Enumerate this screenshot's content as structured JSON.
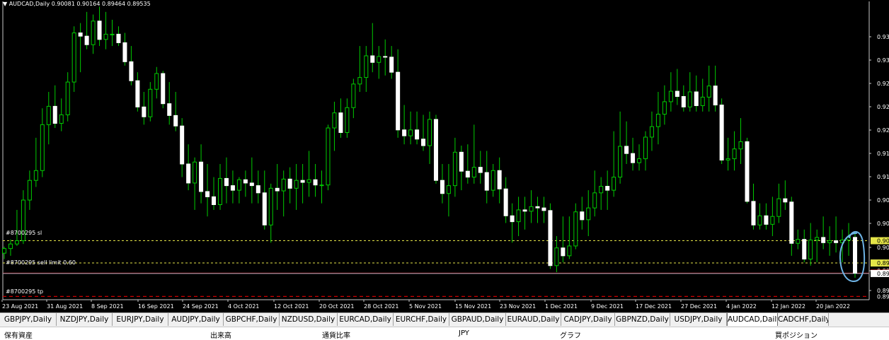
{
  "symbol_header": "AUDCAD,Daily  0.90081 0.90164 0.89464 0.89535",
  "orders": {
    "sl": "#8700295 sl",
    "sell_limit": "#8700295 sell limit 0.60",
    "tp": "#8700295 tp"
  },
  "chart_data": {
    "type": "candlestick",
    "symbol": "AUDCAD",
    "timeframe": "Daily",
    "last_ohlc": {
      "open": 0.90081,
      "high": 0.90164,
      "low": 0.89464,
      "close": 0.89535
    },
    "ylim": [
      0.8913,
      0.9368
    ],
    "y_ticks": [
      "0.93",
      "0.93",
      "0.92",
      "0.92",
      "0.92",
      "0.91",
      "0.91",
      "0.90",
      "0.90",
      "0.90",
      "0.89",
      "0.89"
    ],
    "x_labels": [
      "23 Aug 2021",
      "31 Aug 2021",
      "8 Sep 2021",
      "16 Sep 2021",
      "24 Sep 2021",
      "4 Oct 2021",
      "12 Oct 2021",
      "20 Oct 2021",
      "28 Oct 2021",
      "5 Nov 2021",
      "15 Nov 2021",
      "23 Nov 2021",
      "1 Dec 2021",
      "9 Dec 2021",
      "17 Dec 2021",
      "27 Dec 2021",
      "4 Jan 2022",
      "12 Jan 2022",
      "20 Jan 2022"
    ],
    "price_labels": {
      "sl": "0.90",
      "bid": "0.89",
      "sell_limit": "0.89",
      "ask": "0.89",
      "tp": "0.89"
    },
    "levels": {
      "sl": 0.9003,
      "bid": 0.89535,
      "sell_limit": 0.8969,
      "ask": 0.8953,
      "tp": 0.8918
    },
    "candles": [
      [
        0.8984,
        0.8994,
        0.8975,
        0.8991
      ],
      [
        0.8991,
        0.9005,
        0.898,
        0.8998
      ],
      [
        0.8998,
        0.905,
        0.8995,
        0.9003
      ],
      [
        0.9003,
        0.908,
        0.8998,
        0.9065
      ],
      [
        0.9065,
        0.911,
        0.905,
        0.9095
      ],
      [
        0.9095,
        0.916,
        0.9085,
        0.911
      ],
      [
        0.911,
        0.9205,
        0.91,
        0.918
      ],
      [
        0.918,
        0.923,
        0.915,
        0.9208
      ],
      [
        0.9208,
        0.924,
        0.9175,
        0.9182
      ],
      [
        0.9182,
        0.922,
        0.917,
        0.9195
      ],
      [
        0.9195,
        0.926,
        0.9185,
        0.9245
      ],
      [
        0.9245,
        0.933,
        0.923,
        0.932
      ],
      [
        0.932,
        0.9335,
        0.926,
        0.9315
      ],
      [
        0.9315,
        0.9352,
        0.9295,
        0.9302
      ],
      [
        0.9302,
        0.9348,
        0.9288,
        0.9338
      ],
      [
        0.9338,
        0.936,
        0.93,
        0.931
      ],
      [
        0.931,
        0.9352,
        0.9295,
        0.9318
      ],
      [
        0.9318,
        0.934,
        0.93,
        0.9318
      ],
      [
        0.9318,
        0.933,
        0.93,
        0.9305
      ],
      [
        0.9305,
        0.932,
        0.927,
        0.9276
      ],
      [
        0.9276,
        0.93,
        0.924,
        0.9247
      ],
      [
        0.9247,
        0.926,
        0.92,
        0.9207
      ],
      [
        0.9207,
        0.923,
        0.918,
        0.9192
      ],
      [
        0.9192,
        0.9245,
        0.9185,
        0.9234
      ],
      [
        0.9234,
        0.9268,
        0.922,
        0.9258
      ],
      [
        0.9258,
        0.9262,
        0.9205,
        0.9212
      ],
      [
        0.9212,
        0.9245,
        0.918,
        0.9194
      ],
      [
        0.9194,
        0.923,
        0.917,
        0.9178
      ],
      [
        0.9178,
        0.919,
        0.91,
        0.912
      ],
      [
        0.912,
        0.915,
        0.908,
        0.9091
      ],
      [
        0.9091,
        0.913,
        0.905,
        0.9123
      ],
      [
        0.9123,
        0.915,
        0.906,
        0.9078
      ],
      [
        0.9078,
        0.912,
        0.904,
        0.907
      ],
      [
        0.907,
        0.91,
        0.905,
        0.9058
      ],
      [
        0.9058,
        0.912,
        0.905,
        0.9098
      ],
      [
        0.9098,
        0.913,
        0.906,
        0.9087
      ],
      [
        0.9087,
        0.911,
        0.906,
        0.908
      ],
      [
        0.908,
        0.91,
        0.906,
        0.9096
      ],
      [
        0.9096,
        0.911,
        0.907,
        0.9091
      ],
      [
        0.9091,
        0.913,
        0.906,
        0.9087
      ],
      [
        0.9087,
        0.911,
        0.906,
        0.9076
      ],
      [
        0.9076,
        0.911,
        0.902,
        0.9027
      ],
      [
        0.9027,
        0.909,
        0.9,
        0.9083
      ],
      [
        0.9083,
        0.912,
        0.905,
        0.9079
      ],
      [
        0.9079,
        0.911,
        0.904,
        0.9097
      ],
      [
        0.9097,
        0.9115,
        0.906,
        0.9083
      ],
      [
        0.9083,
        0.912,
        0.905,
        0.9095
      ],
      [
        0.9095,
        0.912,
        0.906,
        0.9092
      ],
      [
        0.9092,
        0.914,
        0.907,
        0.9096
      ],
      [
        0.9096,
        0.912,
        0.907,
        0.9088
      ],
      [
        0.9088,
        0.911,
        0.906,
        0.9088
      ],
      [
        0.9088,
        0.918,
        0.908,
        0.9175
      ],
      [
        0.9175,
        0.9215,
        0.914,
        0.9198
      ],
      [
        0.9198,
        0.922,
        0.916,
        0.9168
      ],
      [
        0.9168,
        0.922,
        0.916,
        0.9206
      ],
      [
        0.9206,
        0.925,
        0.919,
        0.9242
      ],
      [
        0.9242,
        0.93,
        0.923,
        0.9252
      ],
      [
        0.9252,
        0.93,
        0.923,
        0.9285
      ],
      [
        0.9285,
        0.9335,
        0.926,
        0.9275
      ],
      [
        0.9275,
        0.93,
        0.925,
        0.9284
      ],
      [
        0.9284,
        0.931,
        0.9255,
        0.9283
      ],
      [
        0.9283,
        0.93,
        0.925,
        0.926
      ],
      [
        0.926,
        0.9295,
        0.916,
        0.9172
      ],
      [
        0.9172,
        0.921,
        0.915,
        0.9163
      ],
      [
        0.9163,
        0.92,
        0.915,
        0.9172
      ],
      [
        0.9172,
        0.92,
        0.915,
        0.9158
      ],
      [
        0.9158,
        0.9195,
        0.914,
        0.9148
      ],
      [
        0.9148,
        0.92,
        0.912,
        0.9188
      ],
      [
        0.9188,
        0.9195,
        0.909,
        0.9095
      ],
      [
        0.9095,
        0.912,
        0.906,
        0.9075
      ],
      [
        0.9075,
        0.912,
        0.904,
        0.9087
      ],
      [
        0.9087,
        0.916,
        0.907,
        0.9138
      ],
      [
        0.9138,
        0.9148,
        0.908,
        0.9109
      ],
      [
        0.9109,
        0.915,
        0.909,
        0.91
      ],
      [
        0.91,
        0.918,
        0.909,
        0.9115
      ],
      [
        0.9115,
        0.914,
        0.909,
        0.9107
      ],
      [
        0.9107,
        0.914,
        0.906,
        0.908
      ],
      [
        0.908,
        0.912,
        0.907,
        0.911
      ],
      [
        0.911,
        0.913,
        0.906,
        0.9082
      ],
      [
        0.9082,
        0.91,
        0.903,
        0.9041
      ],
      [
        0.9041,
        0.906,
        0.9,
        0.9032
      ],
      [
        0.9032,
        0.907,
        0.901,
        0.905
      ],
      [
        0.905,
        0.907,
        0.902,
        0.9048
      ],
      [
        0.9048,
        0.908,
        0.903,
        0.9055
      ],
      [
        0.9055,
        0.907,
        0.903,
        0.9053
      ],
      [
        0.9053,
        0.907,
        0.903,
        0.9049
      ],
      [
        0.9049,
        0.906,
        0.896,
        0.8965
      ],
      [
        0.8965,
        0.901,
        0.8955,
        0.8992
      ],
      [
        0.8992,
        0.904,
        0.897,
        0.898
      ],
      [
        0.898,
        0.904,
        0.8975,
        0.8995
      ],
      [
        0.8995,
        0.906,
        0.899,
        0.9047
      ],
      [
        0.9047,
        0.907,
        0.902,
        0.9035
      ],
      [
        0.9035,
        0.908,
        0.901,
        0.9053
      ],
      [
        0.9053,
        0.911,
        0.904,
        0.9076
      ],
      [
        0.9076,
        0.91,
        0.905,
        0.9086
      ],
      [
        0.9086,
        0.911,
        0.905,
        0.908
      ],
      [
        0.908,
        0.917,
        0.907,
        0.91
      ],
      [
        0.91,
        0.92,
        0.909,
        0.9147
      ],
      [
        0.9147,
        0.9185,
        0.912,
        0.9136
      ],
      [
        0.9136,
        0.916,
        0.911,
        0.9122
      ],
      [
        0.9122,
        0.915,
        0.911,
        0.9128
      ],
      [
        0.9128,
        0.917,
        0.911,
        0.9161
      ],
      [
        0.9161,
        0.92,
        0.914,
        0.9177
      ],
      [
        0.9177,
        0.923,
        0.915,
        0.9196
      ],
      [
        0.9196,
        0.924,
        0.918,
        0.9215
      ],
      [
        0.9215,
        0.926,
        0.92,
        0.9231
      ],
      [
        0.9231,
        0.9265,
        0.921,
        0.9223
      ],
      [
        0.9223,
        0.924,
        0.92,
        0.9207
      ],
      [
        0.9207,
        0.926,
        0.92,
        0.923
      ],
      [
        0.923,
        0.9255,
        0.92,
        0.9209
      ],
      [
        0.9209,
        0.925,
        0.92,
        0.9222
      ],
      [
        0.9222,
        0.927,
        0.92,
        0.9239
      ],
      [
        0.9239,
        0.927,
        0.92,
        0.921
      ],
      [
        0.921,
        0.922,
        0.912,
        0.9126
      ],
      [
        0.9126,
        0.916,
        0.911,
        0.9128
      ],
      [
        0.9128,
        0.917,
        0.911,
        0.9143
      ],
      [
        0.9143,
        0.919,
        0.912,
        0.9154
      ],
      [
        0.9154,
        0.916,
        0.906,
        0.9063
      ],
      [
        0.9063,
        0.909,
        0.902,
        0.9027
      ],
      [
        0.9027,
        0.906,
        0.902,
        0.9041
      ],
      [
        0.9041,
        0.906,
        0.902,
        0.9028
      ],
      [
        0.9028,
        0.907,
        0.901,
        0.904
      ],
      [
        0.904,
        0.909,
        0.903,
        0.9067
      ],
      [
        0.9067,
        0.9095,
        0.905,
        0.9062
      ],
      [
        0.9062,
        0.907,
        0.898,
        0.8999
      ],
      [
        0.8999,
        0.902,
        0.899,
        0.9005
      ],
      [
        0.9005,
        0.902,
        0.897,
        0.8975
      ],
      [
        0.8975,
        0.903,
        0.8965,
        0.9004
      ],
      [
        0.9004,
        0.902,
        0.897,
        0.9008
      ],
      [
        0.9008,
        0.904,
        0.899,
        0.9
      ],
      [
        0.9,
        0.9025,
        0.898,
        0.9003
      ],
      [
        0.9003,
        0.904,
        0.8985,
        0.9
      ],
      [
        0.9,
        0.902,
        0.897,
        0.9004
      ],
      [
        0.9004,
        0.903,
        0.898,
        0.9008
      ],
      [
        0.90081,
        0.90164,
        0.89464,
        0.89535
      ]
    ]
  },
  "tabs": [
    "GBPJPY,Daily",
    "NZDJPY,Daily",
    "EURJPY,Daily",
    "AUDJPY,Daily",
    "GBPCHF,Daily",
    "NZDUSD,Daily",
    "EURCAD,Daily",
    "EURCHF,Daily",
    "GBPAUD,Daily",
    "EURAUD,Daily",
    "CADJPY,Daily",
    "GBPNZD,Daily",
    "USDJPY,Daily",
    "AUDCAD,Daily",
    "CADCHF,Daily"
  ],
  "active_tab": "AUDCAD,Daily",
  "terminal": {
    "col1": "保有資産",
    "col2": "出来高",
    "col3": "通貨比率",
    "col4": "JPY",
    "col5": "グラフ",
    "col6": "買ポジション"
  },
  "colors": {
    "background": "#000000",
    "bull_body": "#000000",
    "bear_body": "#ffffff",
    "wick": "#00cc00",
    "sl_line": "#e5e548",
    "bid_line": "#cc0000",
    "sell_limit_line": "#e5e548",
    "ask_line": "#a0b4c8",
    "tp_line": "#cc0000",
    "annotation": "#6eb4e6"
  }
}
